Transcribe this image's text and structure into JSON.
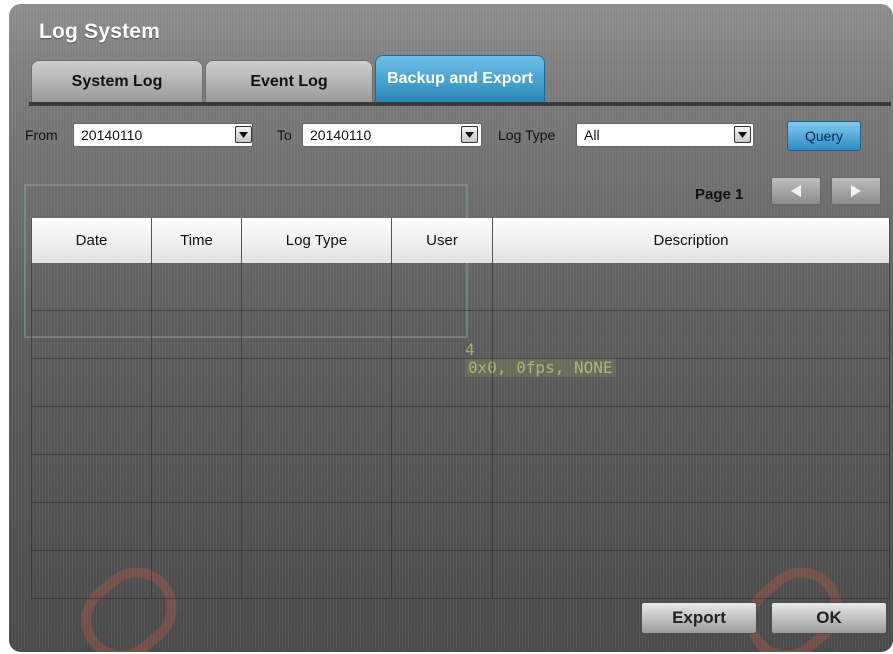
{
  "window": {
    "title": "Log System"
  },
  "tabs": [
    {
      "label": "System Log",
      "active": false
    },
    {
      "label": "Event Log",
      "active": false
    },
    {
      "label": "Backup and Export",
      "active": true
    }
  ],
  "filters": {
    "from_label": "From",
    "from_value": "20140110",
    "to_label": "To",
    "to_value": "20140110",
    "log_type_label": "Log Type",
    "log_type_value": "All",
    "query_label": "Query"
  },
  "pagination": {
    "page_label": "Page 1"
  },
  "table": {
    "columns": [
      "Date",
      "Time",
      "Log Type",
      "User",
      "Description"
    ],
    "rows": []
  },
  "background": {
    "channel_number": "4",
    "stream_info": "0x0, 0fps, NONE"
  },
  "actions": {
    "export_label": "Export",
    "ok_label": "OK"
  },
  "colors": {
    "active_tab": "#3a9ad0",
    "query_button": "#4aa6da"
  },
  "icons": {
    "dropdown": "chevron-down-icon",
    "prev_page": "arrow-left-icon",
    "next_page": "arrow-right-icon"
  }
}
